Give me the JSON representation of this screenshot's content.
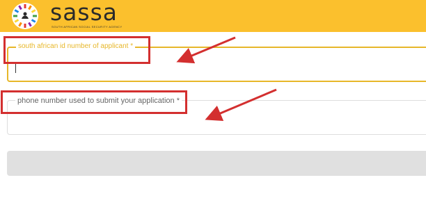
{
  "header": {
    "brand_name": "sassa",
    "brand_tagline": "SOUTH AFRICAN SOCIAL SECURITY AGENCY",
    "background_color": "#fbc02d",
    "logo_icon": "sassa-logo-icon"
  },
  "form": {
    "id_field": {
      "label": "south african id number of applicant *",
      "value": "",
      "accent_color": "#e7b729",
      "state": "focused"
    },
    "phone_field": {
      "label": "phone number used to submit your application *",
      "value": ""
    },
    "submit_button": {
      "label": "",
      "color": "#e0e0e0"
    }
  },
  "annotations": {
    "highlight_color": "#d32f2f",
    "items": [
      "id-field-label-highlight",
      "phone-field-label-highlight",
      "arrow-to-id-field",
      "arrow-to-phone-field"
    ]
  }
}
